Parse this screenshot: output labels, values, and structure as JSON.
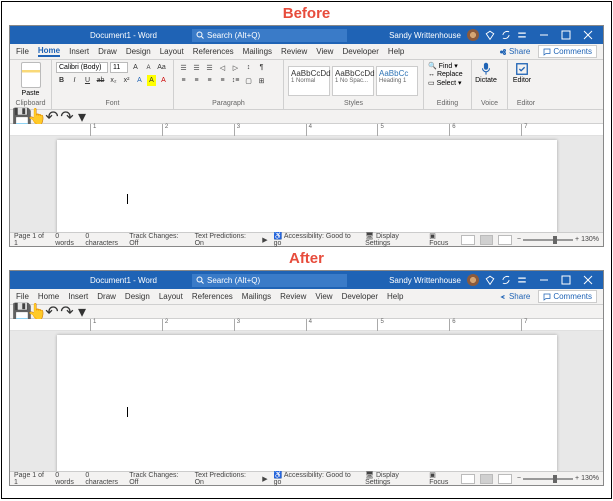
{
  "labels": {
    "before": "Before",
    "after": "After"
  },
  "titlebar": {
    "title": "Document1 - Word",
    "search_placeholder": "Search (Alt+Q)",
    "username": "Sandy Writtenhouse"
  },
  "tabs": [
    "File",
    "Home",
    "Insert",
    "Draw",
    "Design",
    "Layout",
    "References",
    "Mailings",
    "Review",
    "View",
    "Developer",
    "Help"
  ],
  "active_tab": "Home",
  "share": "Share",
  "comments": "Comments",
  "ribbon": {
    "clipboard": {
      "label": "Clipboard",
      "paste": "Paste"
    },
    "font": {
      "label": "Font",
      "family": "Calibri (Body)",
      "size": "11"
    },
    "paragraph": {
      "label": "Paragraph"
    },
    "styles": {
      "label": "Styles",
      "items": [
        {
          "prev": "AaBbCcDd",
          "name": "1 Normal"
        },
        {
          "prev": "AaBbCcDd",
          "name": "1 No Spac..."
        },
        {
          "prev": "AaBbCc",
          "name": "Heading 1"
        }
      ]
    },
    "editing": {
      "label": "Editing",
      "find": "Find",
      "replace": "Replace",
      "select": "Select"
    },
    "voice": {
      "label": "Voice",
      "dictate": "Dictate"
    },
    "editor": {
      "label": "Editor",
      "editor": "Editor"
    }
  },
  "ruler_ticks": [
    "1",
    "2",
    "3",
    "4",
    "5",
    "6",
    "7"
  ],
  "status": {
    "page": "Page 1 of 1",
    "words": "0 words",
    "chars": "0 characters",
    "track": "Track Changes: Off",
    "pred": "Text Predictions: On",
    "access": "Accessibility: Good to go",
    "display": "Display Settings",
    "focus": "Focus",
    "zoom": "130%"
  }
}
